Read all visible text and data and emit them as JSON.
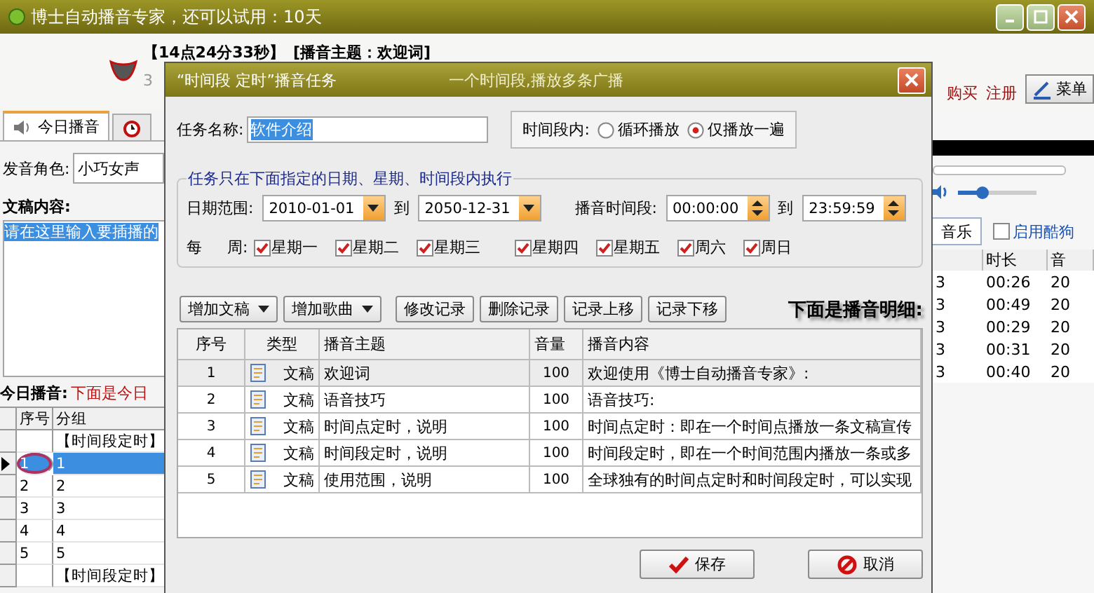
{
  "window": {
    "title": "博士自动播音专家，还可以试用：10天"
  },
  "header": {
    "clock": "【14点24分33秒】",
    "topic": "[播音主题：欢迎词]",
    "counter": "3",
    "links": [
      "购买",
      "注册"
    ],
    "menu_button": "菜单"
  },
  "left_panel": {
    "tabs": [
      {
        "kind": "speaker",
        "label": "今日播音",
        "selected": true
      },
      {
        "kind": "alarm",
        "selected": false
      }
    ],
    "voice_label": "发音角色:",
    "voice": "小巧女声",
    "script_label": "文稿内容:",
    "script_text": "请在这里输入要插播的",
    "today_label": "今日播音:",
    "today_note": "下面是今日",
    "grid": {
      "columns": [
        "序号",
        "分组"
      ],
      "rows": [
        {
          "kind": "group",
          "label": "【时间段定时】",
          "selected": false
        },
        {
          "kind": "item",
          "index": "1",
          "group": "1",
          "selected": true
        },
        {
          "kind": "item",
          "index": "2",
          "group": "2",
          "selected": false
        },
        {
          "kind": "item",
          "index": "3",
          "group": "3",
          "selected": false
        },
        {
          "kind": "item",
          "index": "4",
          "group": "4",
          "selected": false
        },
        {
          "kind": "item",
          "index": "5",
          "group": "5",
          "selected": false
        },
        {
          "kind": "group",
          "label": "【时间段定时】",
          "selected": false
        }
      ]
    }
  },
  "right_panel": {
    "volume": {
      "level": 0.3
    },
    "tab": "音乐",
    "kugou": {
      "label": "启用酷狗",
      "checked": false
    },
    "columns": [
      "时长",
      "音"
    ],
    "rows": [
      {
        "file": "3",
        "duration": "00:26",
        "volume": "20"
      },
      {
        "file": "3",
        "duration": "00:49",
        "volume": "20"
      },
      {
        "file": "3",
        "duration": "00:29",
        "volume": "20"
      },
      {
        "file": "3",
        "duration": "00:31",
        "volume": "20"
      },
      {
        "file": "3",
        "duration": "00:40",
        "volume": "20"
      }
    ]
  },
  "dialog": {
    "title": "“时间段 定时”播音任务",
    "subtitle": "一个时间段,播放多条广播",
    "task_name_label": "任务名称:",
    "task_name": "软件介绍",
    "mode_label": "时间段内:",
    "modes": [
      {
        "label": "循环播放",
        "selected": false
      },
      {
        "label": "仅播放一遍",
        "selected": true
      }
    ],
    "schedule": {
      "legend": "任务只在下面指定的日期、星期、时间段内执行",
      "date_label": "日期范围:",
      "date_from": "2010-01-01",
      "date_to_label": "到",
      "date_to": "2050-12-31",
      "time_label": "播音时间段:",
      "time_from": "00:00:00",
      "time_to_label": "到",
      "time_to": "23:59:59",
      "week_label": "每",
      "week_label_2": "周:",
      "days": [
        {
          "label": "星期一",
          "checked": true
        },
        {
          "label": "星期二",
          "checked": true
        },
        {
          "label": "星期三",
          "checked": true
        },
        {
          "label": "星期四",
          "checked": true
        },
        {
          "label": "星期五",
          "checked": true
        },
        {
          "label": "周六",
          "checked": true
        },
        {
          "label": "周日",
          "checked": true
        }
      ]
    },
    "toolbar": [
      {
        "kind": "dropdown",
        "label": "增加文稿"
      },
      {
        "kind": "dropdown",
        "label": "增加歌曲"
      },
      {
        "kind": "plain",
        "label": "修改记录"
      },
      {
        "kind": "plain",
        "label": "删除记录"
      },
      {
        "kind": "plain",
        "label": "记录上移"
      },
      {
        "kind": "plain",
        "label": "记录下移"
      }
    ],
    "detail_heading": "下面是播音明细:",
    "table": {
      "columns": [
        "序号",
        "类型",
        "播音主题",
        "音量",
        "播音内容"
      ],
      "rows": [
        {
          "index": "1",
          "type": "文稿",
          "topic": "欢迎词",
          "volume": "100",
          "content": "欢迎使用《博士自动播音专家》:",
          "selected": true
        },
        {
          "index": "2",
          "type": "文稿",
          "topic": "语音技巧",
          "volume": "100",
          "content": "语音技巧:",
          "selected": false
        },
        {
          "index": "3",
          "type": "文稿",
          "topic": "时间点定时，说明",
          "volume": "100",
          "content": "时间点定时：即在一个时间点播放一条文稿宣传",
          "selected": false
        },
        {
          "index": "4",
          "type": "文稿",
          "topic": "时间段定时，说明",
          "volume": "100",
          "content": "时间段定时，即在一个时间范围内播放一条或多",
          "selected": false
        },
        {
          "index": "5",
          "type": "文稿",
          "topic": "使用范围，说明",
          "volume": "100",
          "content": "全球独有的时间点定时和时间段定时，可以实现",
          "selected": false
        }
      ]
    },
    "buttons": [
      {
        "kind": "save",
        "label": "保存"
      },
      {
        "kind": "cancel",
        "label": "取消"
      }
    ]
  }
}
